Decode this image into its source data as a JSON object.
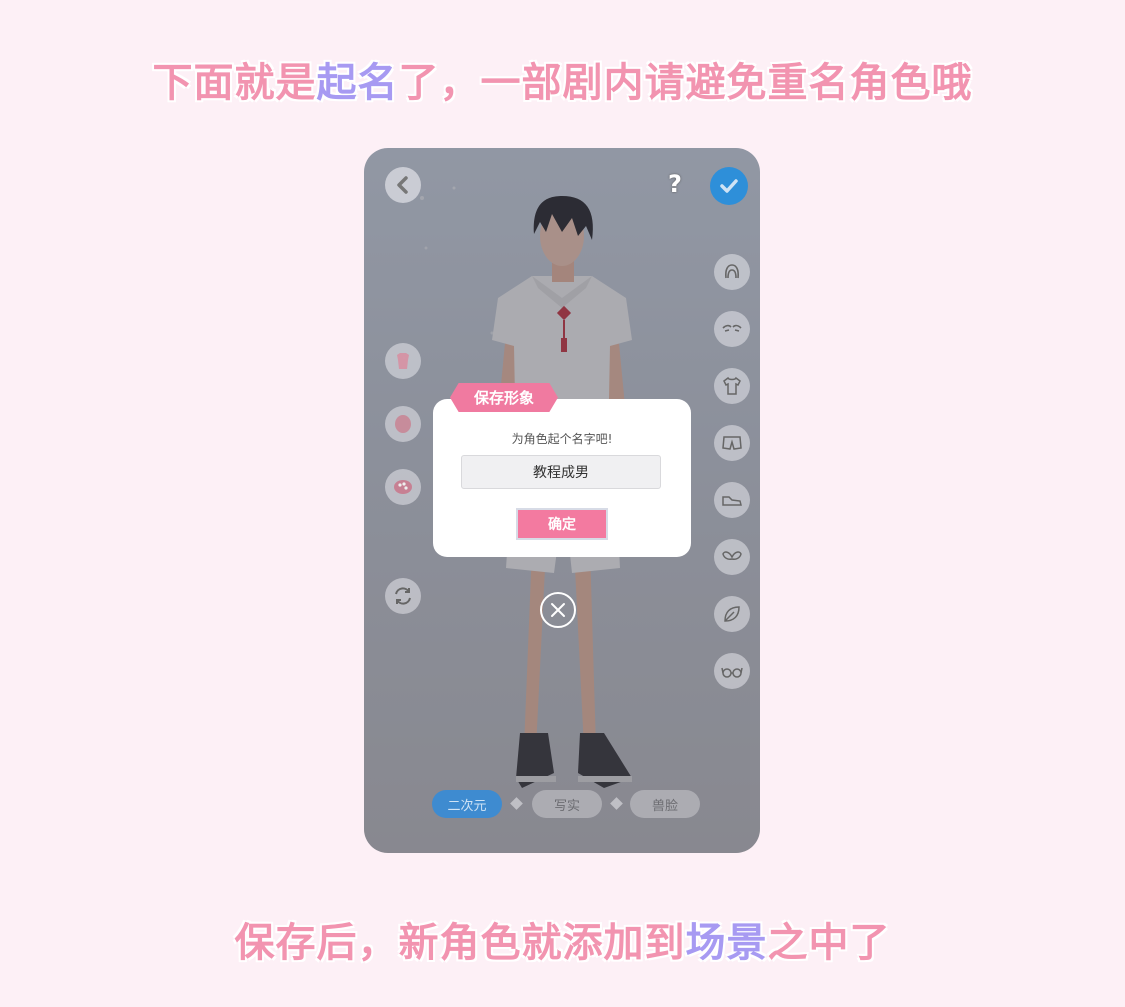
{
  "captions": {
    "top": {
      "pre": "下面就是",
      "hl": "起名",
      "post": "了，一部剧内请避免重名角色哦"
    },
    "bottom": {
      "pre": "保存后，新角色就添加到",
      "hl": "场景",
      "post": "之中了"
    }
  },
  "header": {
    "back_icon": "chevron-left-icon",
    "help_label": "?",
    "confirm_icon": "check-icon"
  },
  "left_tools": [
    {
      "icon": "body-shape-icon"
    },
    {
      "icon": "face-shape-icon"
    },
    {
      "icon": "makeup-palette-icon"
    },
    {
      "icon": "rotate-icon"
    }
  ],
  "right_categories": [
    {
      "icon": "hair-icon"
    },
    {
      "icon": "eyebrow-icon"
    },
    {
      "icon": "shirt-icon"
    },
    {
      "icon": "pants-icon"
    },
    {
      "icon": "shoe-icon"
    },
    {
      "icon": "wings-icon"
    },
    {
      "icon": "leaf-icon"
    },
    {
      "icon": "glasses-icon"
    }
  ],
  "style_tabs": [
    {
      "label": "二次元",
      "active": true
    },
    {
      "label": "写实",
      "active": false
    },
    {
      "label": "兽脸",
      "active": false
    }
  ],
  "dialog": {
    "title": "保存形象",
    "prompt": "为角色起个名字吧!",
    "name_value": "教程成男",
    "ok_label": "确定"
  },
  "colors": {
    "caption_pink": "#f294b0",
    "caption_purple": "#a79af2",
    "accent_blue": "#2e8fd9",
    "dialog_pink": "#f07aa0"
  }
}
